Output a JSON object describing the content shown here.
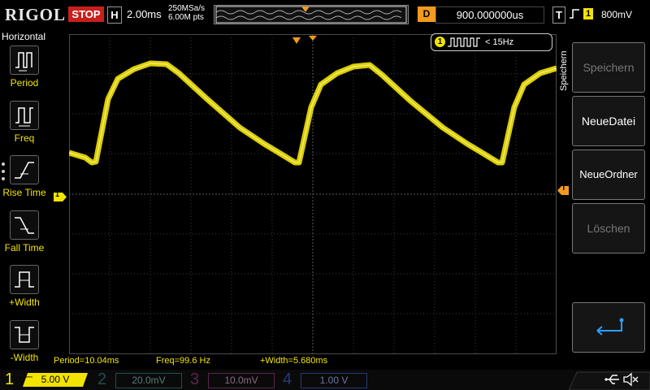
{
  "brand": "RIGOL",
  "run_state": "STOP",
  "horizontal": {
    "label": "H",
    "timebase": "2.00ms",
    "sample_rate": "250MSa/s",
    "points": "6.00M pts"
  },
  "delay": {
    "label": "D",
    "value": "900.000000us"
  },
  "trigger": {
    "label": "T",
    "channel": "1",
    "level": "800mV"
  },
  "left_menu": {
    "title": "Horizontal",
    "items": [
      {
        "label": "Period",
        "icon": "period-icon"
      },
      {
        "label": "Freq",
        "icon": "freq-icon"
      },
      {
        "label": "Rise Time",
        "icon": "rise-time-icon"
      },
      {
        "label": "Fall Time",
        "icon": "fall-time-icon"
      },
      {
        "label": "+Width",
        "icon": "pos-width-icon"
      },
      {
        "label": "-Width",
        "icon": "neg-width-icon"
      }
    ]
  },
  "right_menu": {
    "title": "Speichern",
    "buttons": [
      {
        "label": "Speichern",
        "enabled": false
      },
      {
        "label": "NeueDatei",
        "enabled": true
      },
      {
        "label": "NeueOrdner",
        "enabled": true
      },
      {
        "label": "Löschen",
        "enabled": false
      }
    ]
  },
  "frequency_counter": {
    "channel": "1",
    "value": "< 15Hz"
  },
  "measurements": [
    {
      "text": "Period=10.04ms"
    },
    {
      "text": "Freq=99.6 Hz"
    },
    {
      "text": "+Width=5.680ms"
    }
  ],
  "channels": [
    {
      "number": "1",
      "scale": "5.00 V",
      "color": "#f2e400"
    },
    {
      "number": "2",
      "scale": "20.0mV",
      "color": "#1fb5b1"
    },
    {
      "number": "3",
      "scale": "10.0mV",
      "color": "#c24aa6"
    },
    {
      "number": "4",
      "scale": "1.00 V",
      "color": "#3b63d6"
    }
  ],
  "markers": {
    "ch1_marker": "1",
    "trigger_marker": "T"
  },
  "colors": {
    "accent": "#f2e400",
    "stop": "#c8201c",
    "delay": "#f39a1f",
    "trigger_marker": "#f39a1f"
  }
}
